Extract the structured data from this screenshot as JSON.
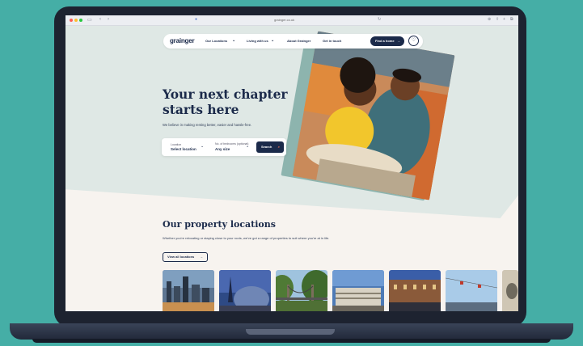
{
  "browser": {
    "url": "grainger.co.uk"
  },
  "nav": {
    "logo": "grainger",
    "links": [
      "Our Locations",
      "Living with us",
      "About Grainger",
      "Get in touch"
    ],
    "find_home": "Find a home"
  },
  "hero": {
    "headline_line1": "Your next chapter",
    "headline_line2": "starts here",
    "subtitle": "We believe in making renting better, easier and hassle-free.",
    "search": {
      "location_label": "Location",
      "location_value": "Select location",
      "bedrooms_label": "No. of bedrooms (optional)",
      "bedrooms_value": "Any size",
      "button": "Search"
    }
  },
  "locations": {
    "title": "Our property locations",
    "subtitle": "Whether you're relocating or staying close to your roots, we've got a range of properties to suit where you're at in life.",
    "view_all": "View all locations"
  },
  "colors": {
    "navy": "#1b2a4a",
    "hero_bg": "#dfe8e5",
    "page_bg": "#45aea6"
  }
}
